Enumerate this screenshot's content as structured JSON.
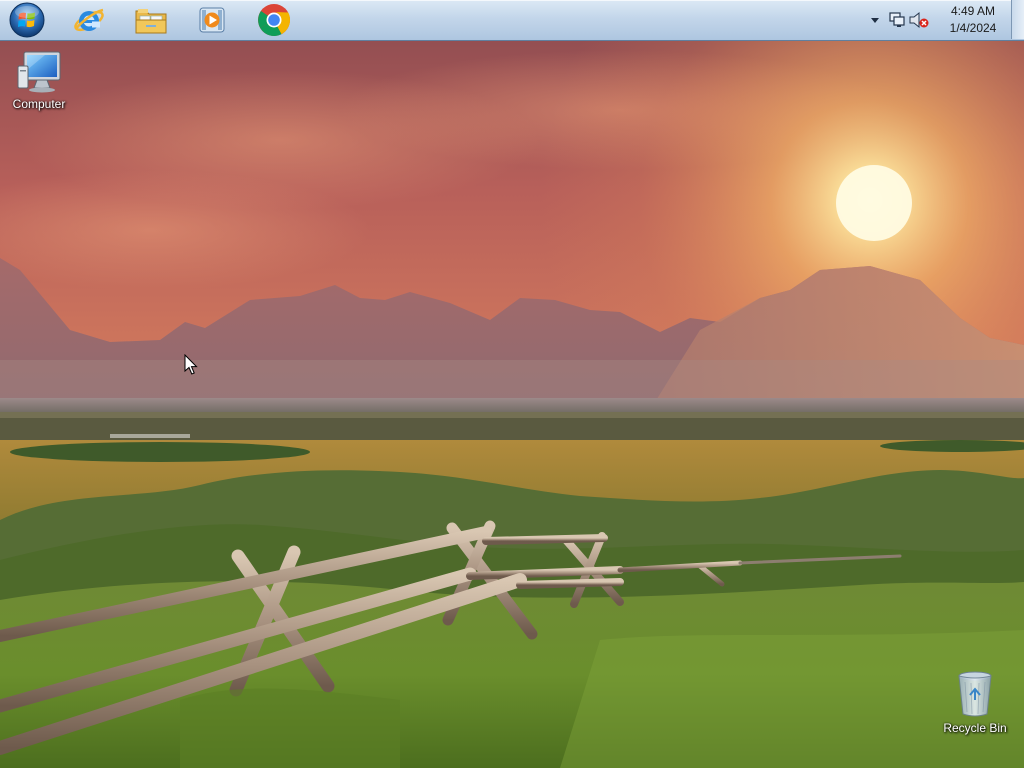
{
  "taskbar": {
    "pinned": [
      {
        "name": "Internet Explorer",
        "icon": "internet-explorer-icon"
      },
      {
        "name": "Windows Explorer",
        "icon": "folder-explorer-icon"
      },
      {
        "name": "Windows Media Player",
        "icon": "media-player-icon"
      },
      {
        "name": "Google Chrome",
        "icon": "chrome-icon"
      }
    ],
    "start_icon": "windows-orb-icon"
  },
  "tray": {
    "icons": [
      "show-hidden-icons-arrow-icon",
      "network-icon",
      "volume-muted-icon"
    ],
    "clock": {
      "time": "4:49 AM",
      "date": "1/4/2024"
    }
  },
  "desktop": {
    "icons": [
      {
        "label": "Computer",
        "icon": "computer-monitor-icon"
      },
      {
        "label": "Recycle Bin",
        "icon": "recycle-bin-icon"
      }
    ]
  },
  "colors": {
    "taskbar_top": "#dce9f5",
    "taskbar_bottom": "#aec6e0",
    "sky_warm": "#f0a060",
    "sun": "#fff6c8",
    "grass": "#5a7a2a"
  }
}
